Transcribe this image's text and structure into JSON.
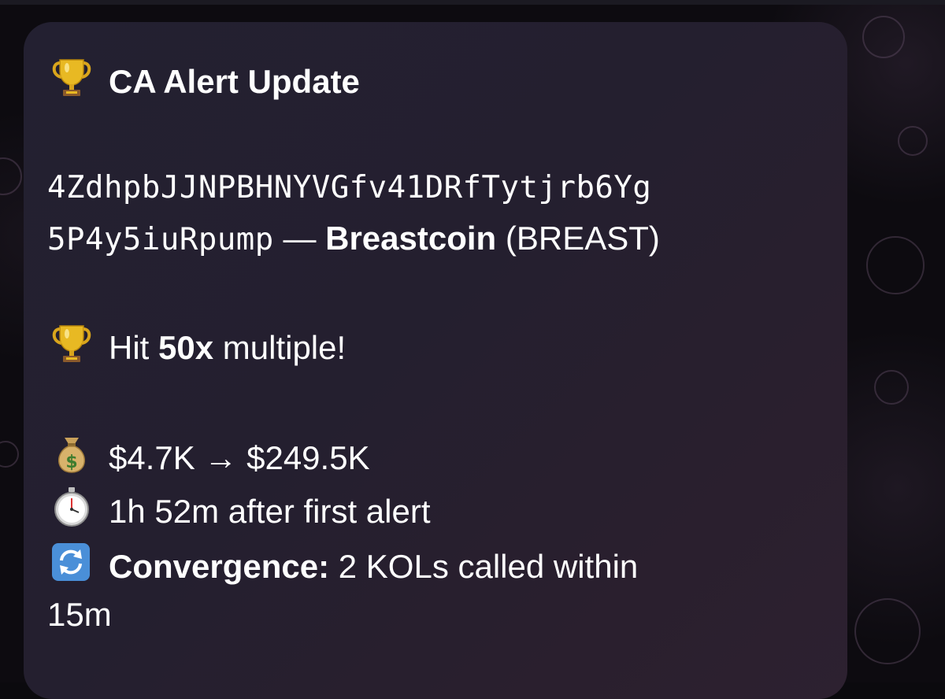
{
  "message": {
    "title_icon": "trophy-icon",
    "title": "CA Alert Update",
    "contract_address_line1": "4ZdhpbJJNPBHNYVGfv41DRfTytjrb6Yg",
    "contract_address_line2": "5P4y5iuRpump",
    "separator": "—",
    "token_name": "Breastcoin",
    "token_ticker": "(BREAST)",
    "hit_icon": "trophy-icon",
    "hit_prefix": "Hit",
    "hit_multiple": "50x",
    "hit_suffix": "multiple!",
    "money_icon": "money-bag-icon",
    "mcap_change": "$4.7K → $249.5K",
    "timer_icon": "stopwatch-icon",
    "time_after": "1h 52m after first alert",
    "convergence_icon": "repeat-arrows-icon",
    "convergence_label": "Convergence:",
    "convergence_text_line1": "2 KOLs called within",
    "convergence_text_line2": "15m"
  },
  "colors": {
    "bubble": "#252031",
    "text": "#ffffff",
    "background": "#0d0b10"
  }
}
